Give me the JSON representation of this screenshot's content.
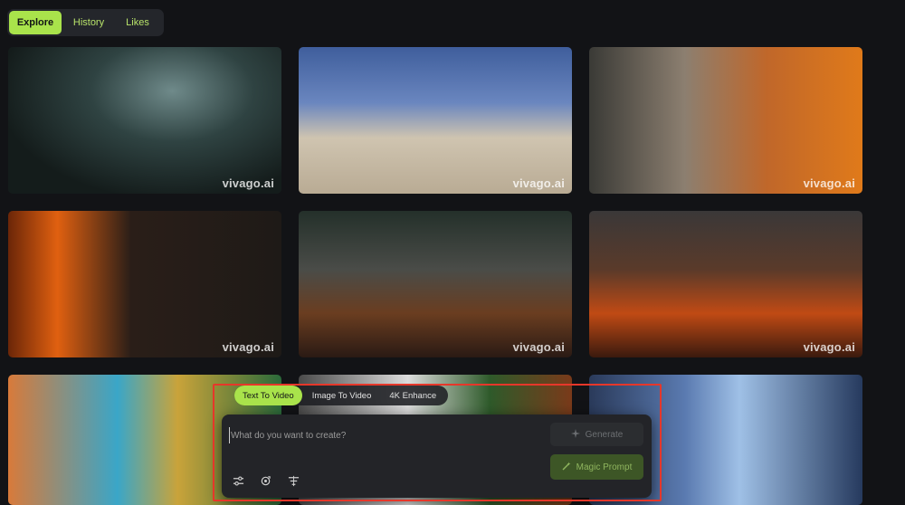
{
  "nav": {
    "tabs": [
      {
        "label": "Explore",
        "active": true
      },
      {
        "label": "History",
        "active": false
      },
      {
        "label": "Likes",
        "active": false
      }
    ]
  },
  "gallery": {
    "watermark": "vivago.ai"
  },
  "composer": {
    "mode_tabs": [
      {
        "label": "Text To Video",
        "active": true
      },
      {
        "label": "Image To Video",
        "active": false
      },
      {
        "label": "4K Enhance",
        "active": false
      }
    ],
    "prompt_placeholder": "What do you want to create?",
    "generate_label": "Generate",
    "magic_prompt_label": "Magic Prompt",
    "tool_icons": [
      "sliders-icon",
      "loop-icon",
      "filter-icon"
    ]
  },
  "colors": {
    "accent": "#a9e34b",
    "highlight_frame": "#e6372a"
  }
}
